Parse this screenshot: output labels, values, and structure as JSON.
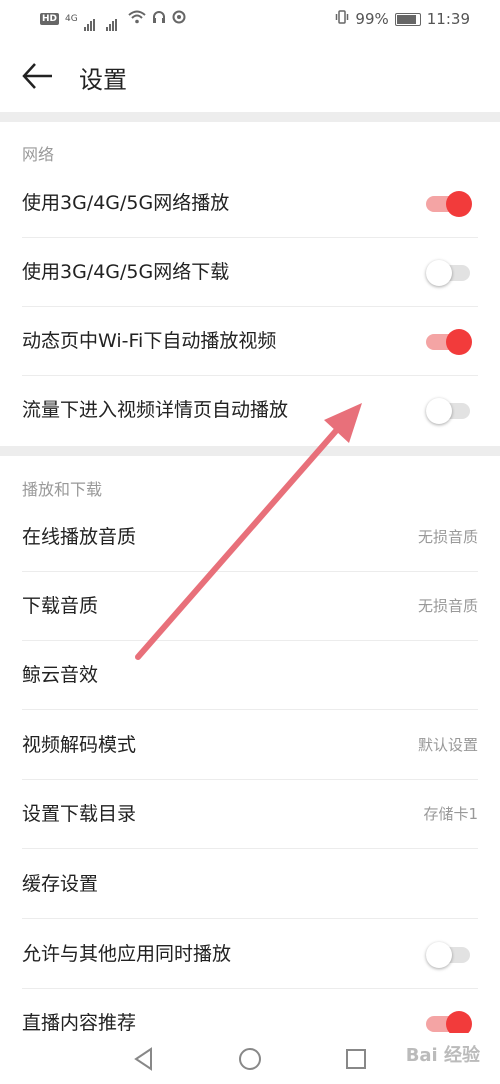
{
  "status_bar": {
    "left_badges": [
      "HD",
      "4G"
    ],
    "battery": "99%",
    "time": "11:39"
  },
  "header": {
    "title": "设置"
  },
  "sections": [
    {
      "label": "网络",
      "items": [
        {
          "label": "使用3G/4G/5G网络播放",
          "toggle": "on"
        },
        {
          "label": "使用3G/4G/5G网络下载",
          "toggle": "off"
        },
        {
          "label": "动态页中Wi-Fi下自动播放视频",
          "toggle": "on"
        },
        {
          "label": "流量下进入视频详情页自动播放",
          "toggle": "off"
        }
      ]
    },
    {
      "label": "播放和下载",
      "items": [
        {
          "label": "在线播放音质",
          "value": "无损音质"
        },
        {
          "label": "下载音质",
          "value": "无损音质"
        },
        {
          "label": "鲸云音效",
          "value": ""
        },
        {
          "label": "视频解码模式",
          "value": "默认设置"
        },
        {
          "label": "设置下载目录",
          "value": "存储卡1"
        },
        {
          "label": "缓存设置",
          "value": ""
        },
        {
          "label": "允许与其他应用同时播放",
          "toggle": "off"
        },
        {
          "label": "直播内容推荐",
          "toggle": "on"
        }
      ]
    }
  ],
  "watermark": "Bai 经验",
  "colors": {
    "accent": "#f23b3b",
    "annotation_arrow": "#e8707a"
  }
}
